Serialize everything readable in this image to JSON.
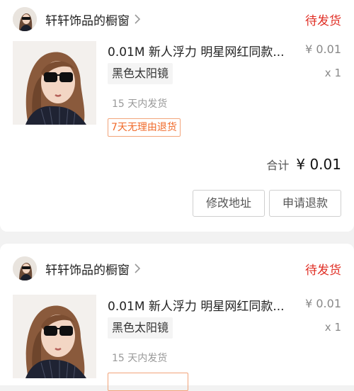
{
  "orders": [
    {
      "shop_name": "轩轩饰品的橱窗",
      "status": "待发货",
      "product_title": "0.01M  新人浮力 明星网红同款...",
      "price": "¥ 0.01",
      "variant": "黑色太阳镜",
      "quantity": "x 1",
      "ship_time": "15 天内发货",
      "return_tag": "7天无理由退货",
      "total_label": "合计",
      "total_value": "¥ 0.01",
      "buttons": {
        "change_address": "修改地址",
        "refund": "申请退款"
      }
    },
    {
      "shop_name": "轩轩饰品的橱窗",
      "status": "待发货",
      "product_title": "0.01M  新人浮力 明星网红同款...",
      "price": "¥ 0.01",
      "variant": "黑色太阳镜",
      "quantity": "x 1",
      "ship_time": "15 天内发货"
    }
  ],
  "icons": {
    "chevron": "chevron-right-icon"
  },
  "colors": {
    "status": "#e02e24",
    "tag": "#f06a2a",
    "background": "#f2f2f2"
  }
}
